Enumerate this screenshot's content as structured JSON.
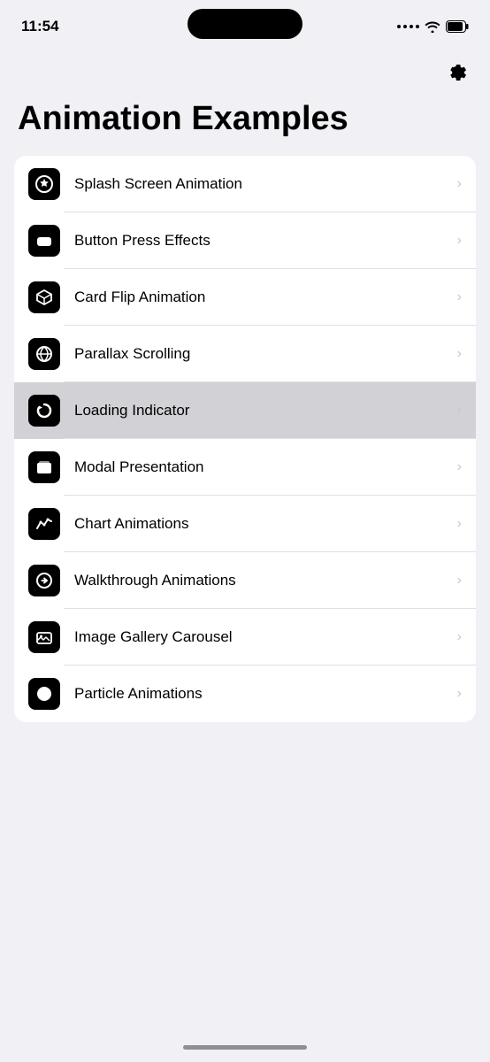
{
  "statusBar": {
    "time": "11:54"
  },
  "settings": {
    "icon": "⚙"
  },
  "pageTitle": "Animation Examples",
  "listItems": [
    {
      "id": "splash-screen",
      "label": "Splash Screen Animation",
      "iconType": "star"
    },
    {
      "id": "button-press",
      "label": "Button Press Effects",
      "iconType": "roundrect"
    },
    {
      "id": "card-flip",
      "label": "Card Flip Animation",
      "iconType": "cube"
    },
    {
      "id": "parallax-scrolling",
      "label": "Parallax Scrolling",
      "iconType": "lines"
    },
    {
      "id": "loading-indicator",
      "label": "Loading Indicator",
      "iconType": "refresh",
      "highlighted": true
    },
    {
      "id": "modal-presentation",
      "label": "Modal Presentation",
      "iconType": "stack"
    },
    {
      "id": "chart-animations",
      "label": "Chart Animations",
      "iconType": "chart"
    },
    {
      "id": "walkthrough-animations",
      "label": "Walkthrough Animations",
      "iconType": "arrow-circle"
    },
    {
      "id": "image-gallery",
      "label": "Image Gallery Carousel",
      "iconType": "gallery"
    },
    {
      "id": "particle-animations",
      "label": "Particle Animations",
      "iconType": "circle"
    }
  ]
}
